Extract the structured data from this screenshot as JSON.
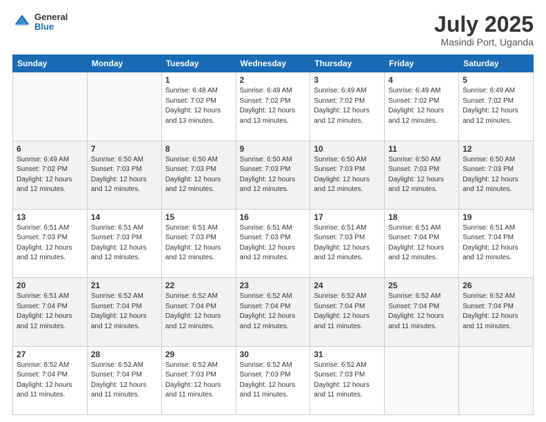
{
  "logo": {
    "general": "General",
    "blue": "Blue"
  },
  "header": {
    "month": "July 2025",
    "location": "Masindi Port, Uganda"
  },
  "days_of_week": [
    "Sunday",
    "Monday",
    "Tuesday",
    "Wednesday",
    "Thursday",
    "Friday",
    "Saturday"
  ],
  "weeks": [
    [
      {
        "day": "",
        "info": ""
      },
      {
        "day": "",
        "info": ""
      },
      {
        "day": "1",
        "info": "Sunrise: 6:48 AM\nSunset: 7:02 PM\nDaylight: 12 hours\nand 13 minutes."
      },
      {
        "day": "2",
        "info": "Sunrise: 6:49 AM\nSunset: 7:02 PM\nDaylight: 12 hours\nand 13 minutes."
      },
      {
        "day": "3",
        "info": "Sunrise: 6:49 AM\nSunset: 7:02 PM\nDaylight: 12 hours\nand 12 minutes."
      },
      {
        "day": "4",
        "info": "Sunrise: 6:49 AM\nSunset: 7:02 PM\nDaylight: 12 hours\nand 12 minutes."
      },
      {
        "day": "5",
        "info": "Sunrise: 6:49 AM\nSunset: 7:02 PM\nDaylight: 12 hours\nand 12 minutes."
      }
    ],
    [
      {
        "day": "6",
        "info": "Sunrise: 6:49 AM\nSunset: 7:02 PM\nDaylight: 12 hours\nand 12 minutes."
      },
      {
        "day": "7",
        "info": "Sunrise: 6:50 AM\nSunset: 7:03 PM\nDaylight: 12 hours\nand 12 minutes."
      },
      {
        "day": "8",
        "info": "Sunrise: 6:50 AM\nSunset: 7:03 PM\nDaylight: 12 hours\nand 12 minutes."
      },
      {
        "day": "9",
        "info": "Sunrise: 6:50 AM\nSunset: 7:03 PM\nDaylight: 12 hours\nand 12 minutes."
      },
      {
        "day": "10",
        "info": "Sunrise: 6:50 AM\nSunset: 7:03 PM\nDaylight: 12 hours\nand 12 minutes."
      },
      {
        "day": "11",
        "info": "Sunrise: 6:50 AM\nSunset: 7:03 PM\nDaylight: 12 hours\nand 12 minutes."
      },
      {
        "day": "12",
        "info": "Sunrise: 6:50 AM\nSunset: 7:03 PM\nDaylight: 12 hours\nand 12 minutes."
      }
    ],
    [
      {
        "day": "13",
        "info": "Sunrise: 6:51 AM\nSunset: 7:03 PM\nDaylight: 12 hours\nand 12 minutes."
      },
      {
        "day": "14",
        "info": "Sunrise: 6:51 AM\nSunset: 7:03 PM\nDaylight: 12 hours\nand 12 minutes."
      },
      {
        "day": "15",
        "info": "Sunrise: 6:51 AM\nSunset: 7:03 PM\nDaylight: 12 hours\nand 12 minutes."
      },
      {
        "day": "16",
        "info": "Sunrise: 6:51 AM\nSunset: 7:03 PM\nDaylight: 12 hours\nand 12 minutes."
      },
      {
        "day": "17",
        "info": "Sunrise: 6:51 AM\nSunset: 7:03 PM\nDaylight: 12 hours\nand 12 minutes."
      },
      {
        "day": "18",
        "info": "Sunrise: 6:51 AM\nSunset: 7:04 PM\nDaylight: 12 hours\nand 12 minutes."
      },
      {
        "day": "19",
        "info": "Sunrise: 6:51 AM\nSunset: 7:04 PM\nDaylight: 12 hours\nand 12 minutes."
      }
    ],
    [
      {
        "day": "20",
        "info": "Sunrise: 6:51 AM\nSunset: 7:04 PM\nDaylight: 12 hours\nand 12 minutes."
      },
      {
        "day": "21",
        "info": "Sunrise: 6:52 AM\nSunset: 7:04 PM\nDaylight: 12 hours\nand 12 minutes."
      },
      {
        "day": "22",
        "info": "Sunrise: 6:52 AM\nSunset: 7:04 PM\nDaylight: 12 hours\nand 12 minutes."
      },
      {
        "day": "23",
        "info": "Sunrise: 6:52 AM\nSunset: 7:04 PM\nDaylight: 12 hours\nand 12 minutes."
      },
      {
        "day": "24",
        "info": "Sunrise: 6:52 AM\nSunset: 7:04 PM\nDaylight: 12 hours\nand 11 minutes."
      },
      {
        "day": "25",
        "info": "Sunrise: 6:52 AM\nSunset: 7:04 PM\nDaylight: 12 hours\nand 11 minutes."
      },
      {
        "day": "26",
        "info": "Sunrise: 6:52 AM\nSunset: 7:04 PM\nDaylight: 12 hours\nand 11 minutes."
      }
    ],
    [
      {
        "day": "27",
        "info": "Sunrise: 6:52 AM\nSunset: 7:04 PM\nDaylight: 12 hours\nand 11 minutes."
      },
      {
        "day": "28",
        "info": "Sunrise: 6:52 AM\nSunset: 7:04 PM\nDaylight: 12 hours\nand 11 minutes."
      },
      {
        "day": "29",
        "info": "Sunrise: 6:52 AM\nSunset: 7:03 PM\nDaylight: 12 hours\nand 11 minutes."
      },
      {
        "day": "30",
        "info": "Sunrise: 6:52 AM\nSunset: 7:03 PM\nDaylight: 12 hours\nand 11 minutes."
      },
      {
        "day": "31",
        "info": "Sunrise: 6:52 AM\nSunset: 7:03 PM\nDaylight: 12 hours\nand 11 minutes."
      },
      {
        "day": "",
        "info": ""
      },
      {
        "day": "",
        "info": ""
      }
    ]
  ]
}
